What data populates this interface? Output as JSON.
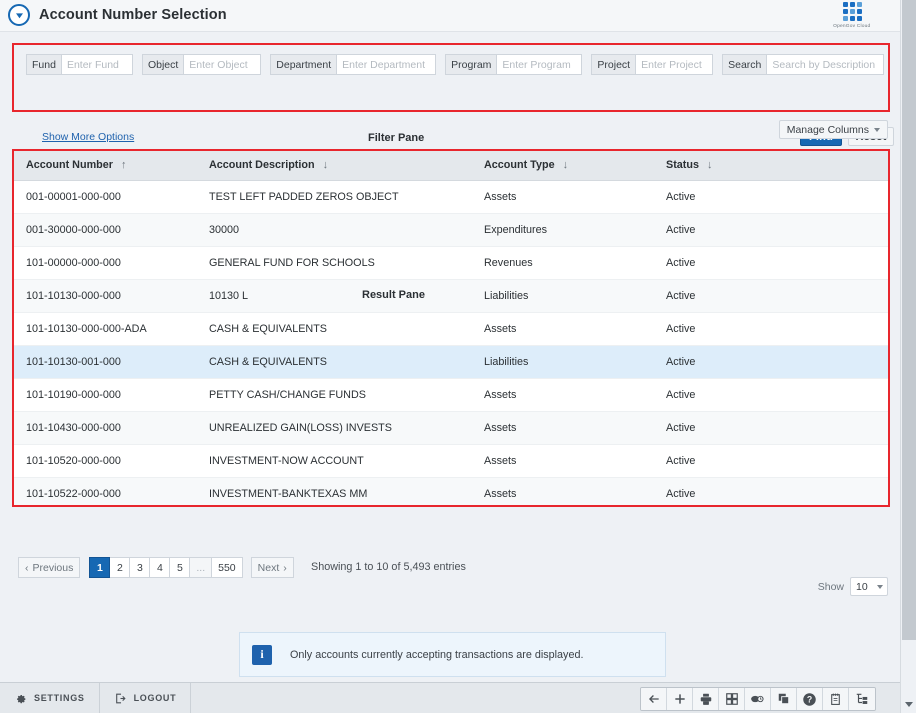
{
  "header": {
    "title": "Account Number Selection",
    "collapse_icon": "circle-chevron-down-icon",
    "brand_name": "OpenGov Cloud"
  },
  "filter_pane": {
    "caption": "Filter Pane",
    "show_more_label": "Show More Options",
    "fields": [
      {
        "label": "Fund",
        "placeholder": "Enter Fund",
        "value": "",
        "width_class": "w-fund",
        "name": "fund"
      },
      {
        "label": "Object",
        "placeholder": "Enter Object",
        "value": "",
        "width_class": "w-object",
        "name": "object"
      },
      {
        "label": "Department",
        "placeholder": "Enter Department",
        "value": "",
        "width_class": "w-department",
        "name": "department"
      },
      {
        "label": "Program",
        "placeholder": "Enter Program",
        "value": "",
        "width_class": "w-program",
        "name": "program"
      },
      {
        "label": "Project",
        "placeholder": "Enter Project",
        "value": "",
        "width_class": "w-project",
        "name": "project"
      },
      {
        "label": "Search",
        "placeholder": "Search by Description",
        "value": "",
        "width_class": "w-search",
        "name": "search"
      }
    ],
    "find_label": "Find",
    "reset_label": "Reset"
  },
  "toolbar": {
    "manage_columns_label": "Manage Columns"
  },
  "result_pane": {
    "caption": "Result Pane",
    "columns": [
      {
        "label": "Account Number",
        "sort": "asc",
        "sort_glyph": "↑"
      },
      {
        "label": "Account Description",
        "sort": "none",
        "sort_glyph": "↓"
      },
      {
        "label": "Account  Type",
        "sort": "none",
        "sort_glyph": "↓"
      },
      {
        "label": "Status",
        "sort": "none",
        "sort_glyph": "↓"
      }
    ],
    "rows": [
      {
        "account_number": "001-00001-000-000",
        "description": "TEST LEFT PADDED ZEROS OBJECT",
        "type": "Assets",
        "status": "Active",
        "selected": false
      },
      {
        "account_number": "001-30000-000-000",
        "description": "30000",
        "type": "Expenditures",
        "status": "Active",
        "selected": false
      },
      {
        "account_number": "101-00000-000-000",
        "description": "GENERAL FUND FOR SCHOOLS",
        "type": "Revenues",
        "status": "Active",
        "selected": false
      },
      {
        "account_number": "101-10130-000-000",
        "description": "10130 L",
        "type": "Liabilities",
        "status": "Active",
        "selected": false
      },
      {
        "account_number": "101-10130-000-000-ADA",
        "description": "CASH & EQUIVALENTS",
        "type": "Assets",
        "status": "Active",
        "selected": false
      },
      {
        "account_number": "101-10130-001-000",
        "description": "CASH & EQUIVALENTS",
        "type": "Liabilities",
        "status": "Active",
        "selected": true
      },
      {
        "account_number": "101-10190-000-000",
        "description": "PETTY CASH/CHANGE FUNDS",
        "type": "Assets",
        "status": "Active",
        "selected": false
      },
      {
        "account_number": "101-10430-000-000",
        "description": "UNREALIZED GAIN(LOSS) INVESTS",
        "type": "Assets",
        "status": "Active",
        "selected": false
      },
      {
        "account_number": "101-10520-000-000",
        "description": "INVESTMENT-NOW ACCOUNT",
        "type": "Assets",
        "status": "Active",
        "selected": false
      },
      {
        "account_number": "101-10522-000-000",
        "description": "INVESTMENT-BANKTEXAS MM",
        "type": "Assets",
        "status": "Active",
        "selected": false
      }
    ]
  },
  "pagination": {
    "previous_label": "Previous",
    "next_label": "Next",
    "pages": [
      "1",
      "2",
      "3",
      "4",
      "5",
      "...",
      "550"
    ],
    "active_page": "1",
    "entries_text": "Showing 1 to 10 of 5,493 entries",
    "show_label": "Show",
    "page_size": "10"
  },
  "info_banner": {
    "icon": "info-icon",
    "glyph": "i",
    "text": "Only accounts currently accepting transactions are displayed."
  },
  "bottom_bar": {
    "items": [
      {
        "label": "SETTINGS",
        "icon": "gear-icon"
      },
      {
        "label": "LOGOUT",
        "icon": "logout-icon"
      }
    ],
    "tools": [
      {
        "name": "back-arrow-icon"
      },
      {
        "name": "add-plus-icon"
      },
      {
        "name": "print-icon"
      },
      {
        "name": "grid-modules-icon"
      },
      {
        "name": "history-clock-icon"
      },
      {
        "name": "copy-layers-icon"
      },
      {
        "name": "help-question-icon"
      },
      {
        "name": "notepad-icon"
      },
      {
        "name": "tree-hierarchy-icon"
      }
    ]
  },
  "colors": {
    "accent_blue": "#1668b3",
    "highlight_red": "#e8262d",
    "selected_row": "#ddedfa",
    "page_bg": "#eef1f5"
  }
}
